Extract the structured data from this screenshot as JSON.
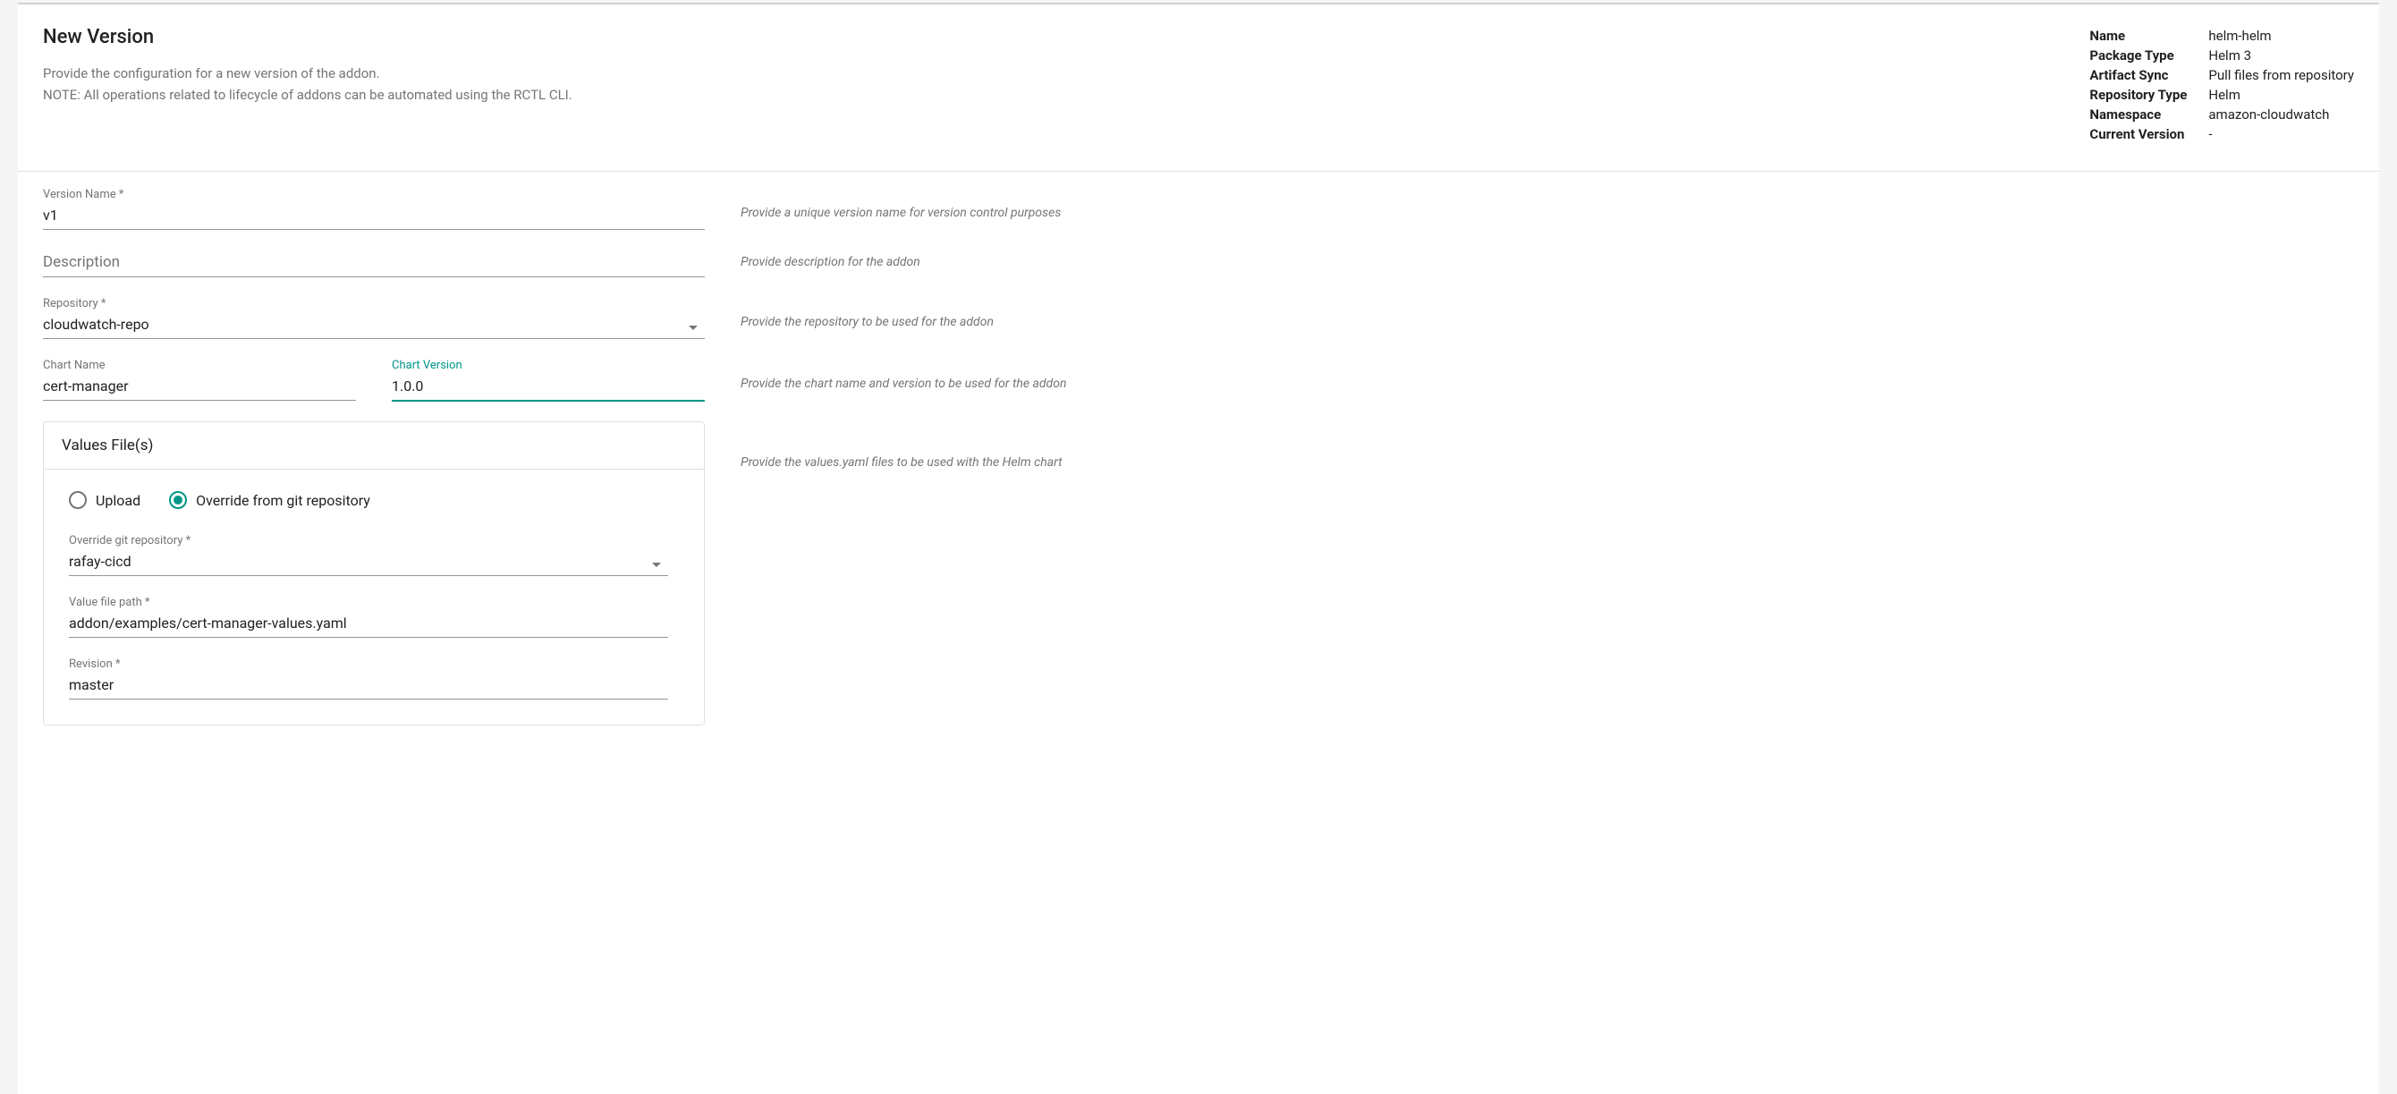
{
  "header": {
    "title": "New Version",
    "subtitle_line1": "Provide the configuration for a new version of the addon.",
    "subtitle_line2": "NOTE: All operations related to lifecycle of addons can be automated using the RCTL CLI."
  },
  "meta": {
    "name_label": "Name",
    "name_value": "helm-helm",
    "package_type_label": "Package Type",
    "package_type_value": "Helm 3",
    "artifact_sync_label": "Artifact Sync",
    "artifact_sync_value": "Pull files from repository",
    "repository_type_label": "Repository Type",
    "repository_type_value": "Helm",
    "namespace_label": "Namespace",
    "namespace_value": "amazon-cloudwatch",
    "current_version_label": "Current Version",
    "current_version_value": "-"
  },
  "form": {
    "version_name": {
      "label": "Version Name *",
      "value": "v1",
      "hint": "Provide a unique version name for version control purposes"
    },
    "description": {
      "placeholder": "Description",
      "value": "",
      "hint": "Provide description for the addon"
    },
    "repository": {
      "label": "Repository *",
      "value": "cloudwatch-repo",
      "hint": "Provide the repository to be used for the addon"
    },
    "chart_name": {
      "label": "Chart Name",
      "value": "cert-manager"
    },
    "chart_version": {
      "label": "Chart Version",
      "value": "1.0.0"
    },
    "chart_hint": "Provide the chart name and version to be used for the addon",
    "values_files": {
      "title": "Values File(s)",
      "hint": "Provide the values.yaml files to be used with the Helm chart",
      "mode_upload": "Upload",
      "mode_override": "Override from git repository",
      "override_repo": {
        "label": "Override git repository *",
        "value": "rafay-cicd"
      },
      "value_file_path": {
        "label": "Value file path *",
        "value": "addon/examples/cert-manager-values.yaml"
      },
      "revision": {
        "label": "Revision *",
        "value": "master"
      }
    }
  }
}
